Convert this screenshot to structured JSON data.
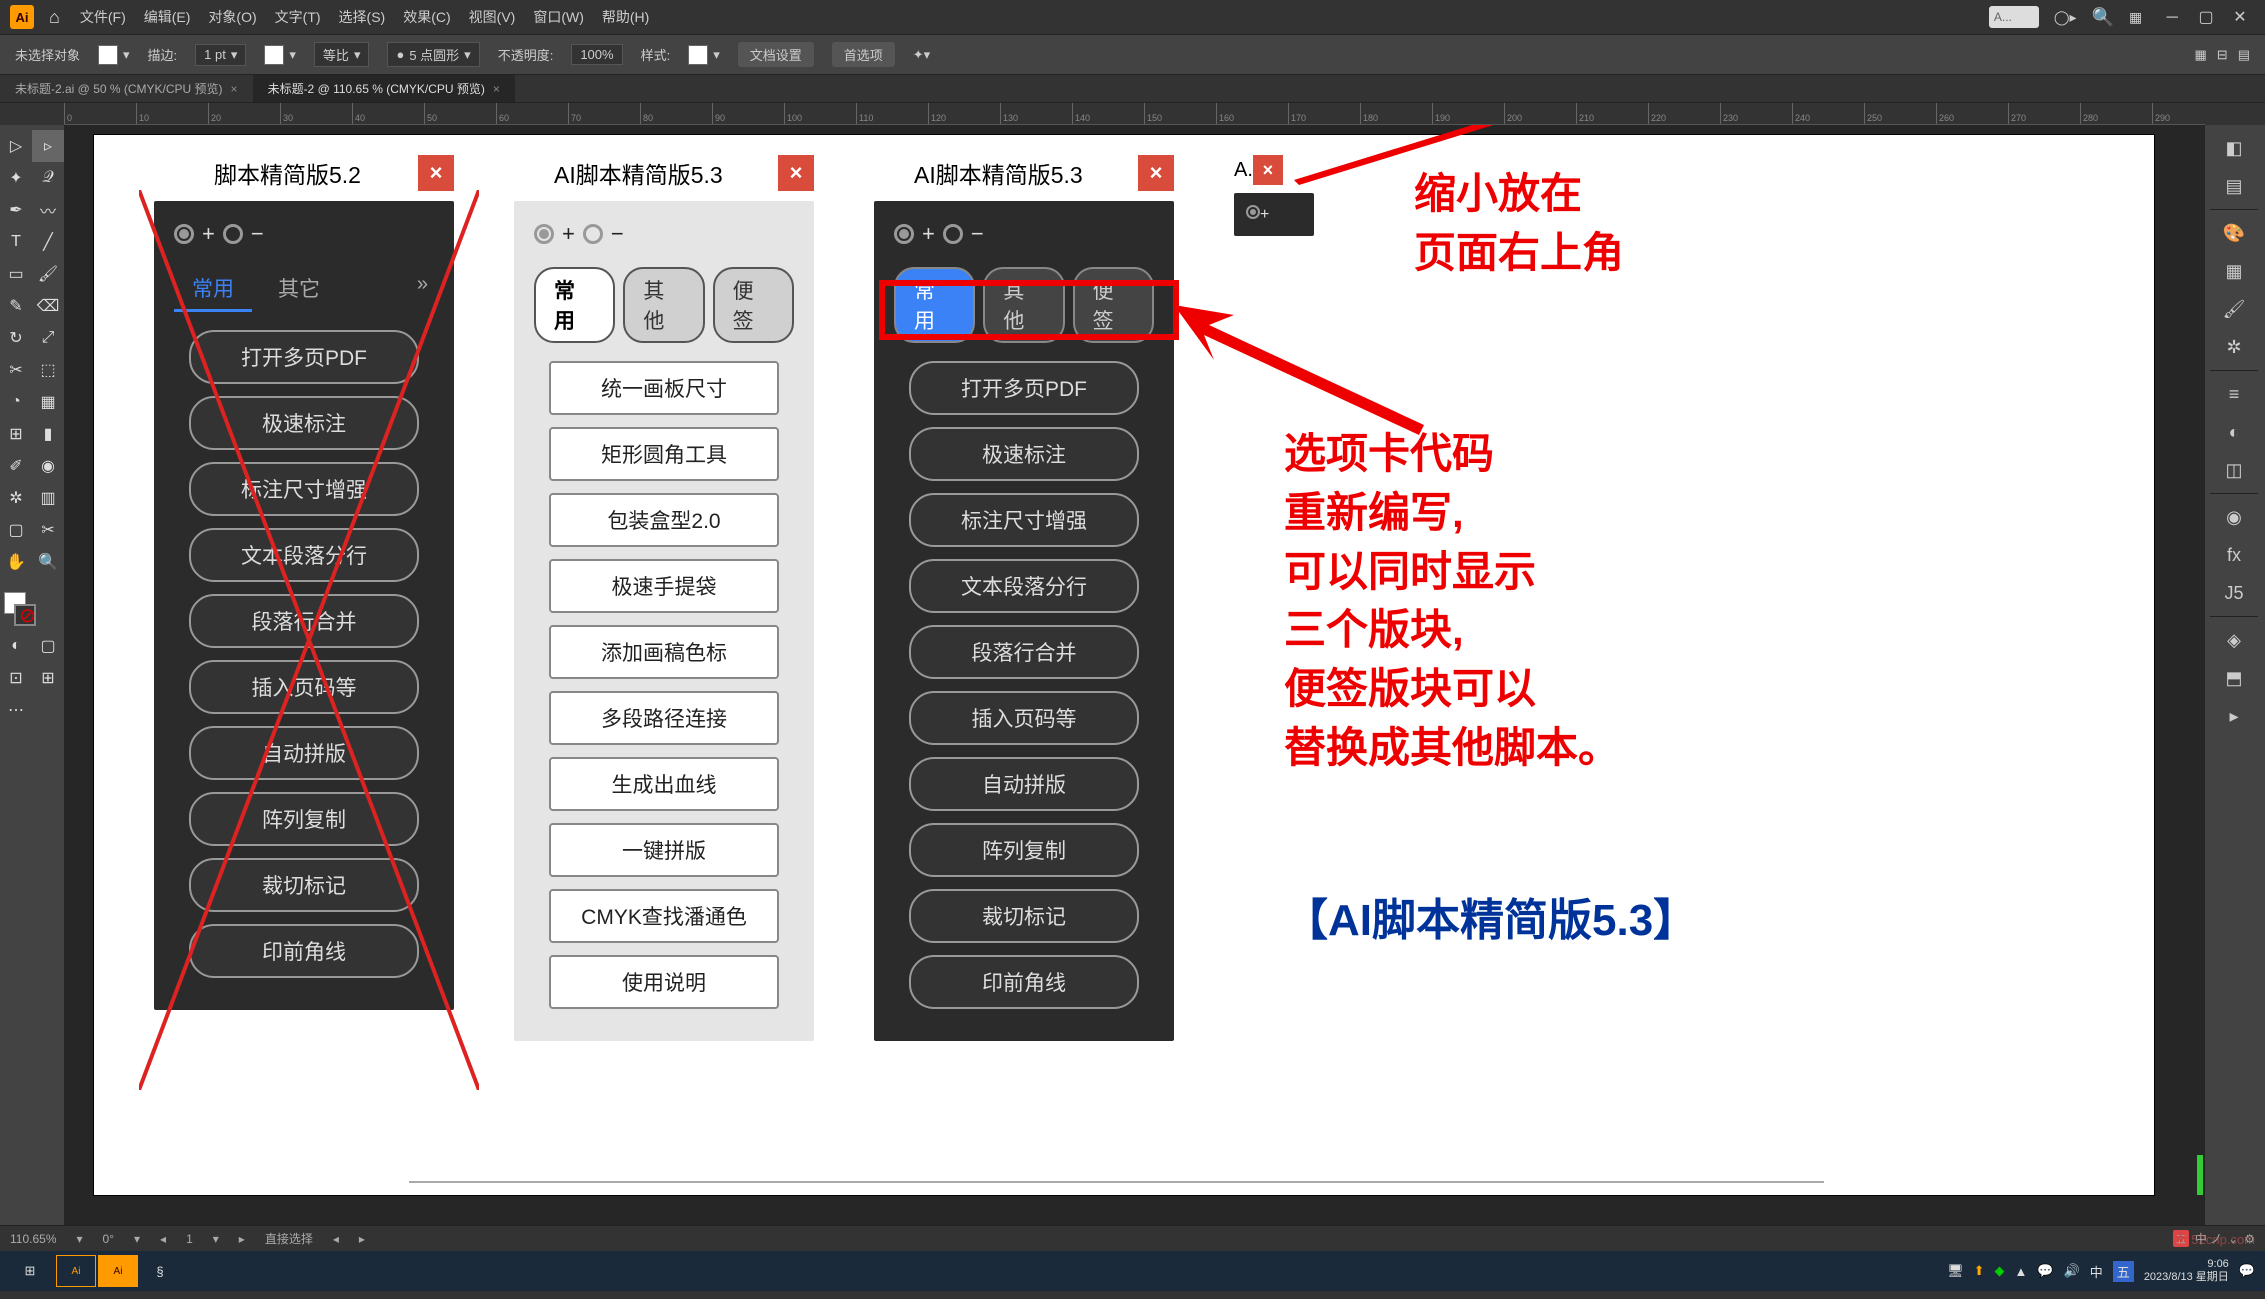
{
  "menubar": {
    "logo": "Ai",
    "menus": [
      "文件(F)",
      "编辑(E)",
      "对象(O)",
      "文字(T)",
      "选择(S)",
      "效果(C)",
      "视图(V)",
      "窗口(W)",
      "帮助(H)"
    ],
    "search_placeholder": "A..."
  },
  "ctrlbar": {
    "no_selection": "未选择对象",
    "stroke_label": "描边:",
    "stroke_val": "1 pt",
    "uniform": "等比",
    "brush": "5 点圆形",
    "opacity_label": "不透明度:",
    "opacity_val": "100%",
    "style_label": "样式:",
    "doc_setup": "文档设置",
    "prefs": "首选项"
  },
  "tabs": [
    {
      "label": "未标题-2.ai @ 50 % (CMYK/CPU 预览)",
      "active": false
    },
    {
      "label": "未标题-2 @ 110.65 % (CMYK/CPU 预览)",
      "active": true
    }
  ],
  "ruler_ticks": [
    "0",
    "10",
    "20",
    "30",
    "40",
    "50",
    "60",
    "70",
    "80",
    "90",
    "100",
    "110",
    "120",
    "130",
    "140",
    "150",
    "160",
    "170",
    "180",
    "190",
    "200",
    "210",
    "220",
    "230",
    "240",
    "250",
    "260",
    "270",
    "280",
    "290"
  ],
  "panels": {
    "p52": {
      "title": "脚本精简版5.2",
      "tabs": [
        "常用",
        "其它"
      ],
      "buttons": [
        "打开多页PDF",
        "极速标注",
        "标注尺寸增强",
        "文本段落分行",
        "段落行合并",
        "插入页码等",
        "自动拼版",
        "阵列复制",
        "裁切标记",
        "印前角线"
      ]
    },
    "p53light": {
      "title": "AI脚本精简版5.3",
      "tabs": [
        "常用",
        "其他",
        "便签"
      ],
      "buttons": [
        "统一画板尺寸",
        "矩形圆角工具",
        "包装盒型2.0",
        "极速手提袋",
        "添加画稿色标",
        "多段路径连接",
        "生成出血线",
        "一键拼版",
        "CMYK查找潘通色",
        "使用说明"
      ]
    },
    "p53dark": {
      "title": "AI脚本精简版5.3",
      "tabs": [
        "常用",
        "其他",
        "便签"
      ],
      "buttons": [
        "打开多页PDF",
        "极速标注",
        "标注尺寸增强",
        "文本段落分行",
        "段落行合并",
        "插入页码等",
        "自动拼版",
        "阵列复制",
        "裁切标记",
        "印前角线"
      ]
    },
    "mini": {
      "title": "A."
    }
  },
  "annotations": {
    "top": "缩小放在\n页面右上角",
    "mid": "选项卡代码\n重新编写,\n可以同时显示\n三个版块,\n便签版块可以\n替换成其他脚本。",
    "bottom": "【AI脚本精简版5.3】"
  },
  "statusbar": {
    "zoom": "110.65%",
    "rot": "0°",
    "page": "1",
    "tool": "直接选择"
  },
  "taskbar": {
    "time": "9:06",
    "date": "2023/8/13 星期日"
  },
  "watermark": "52cnp.com"
}
